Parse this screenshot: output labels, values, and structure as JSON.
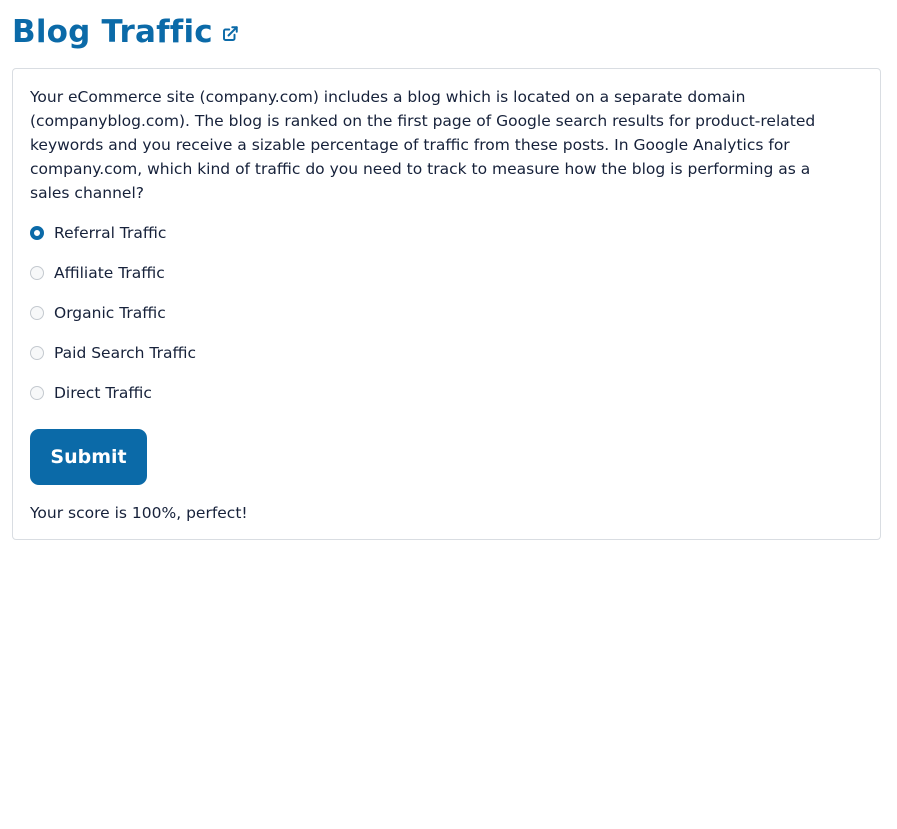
{
  "header": {
    "title": "Blog Traffic",
    "link_icon": "external-link-icon"
  },
  "quiz": {
    "question": "Your eCommerce site (company.com) includes a blog which is located on a separate domain (companyblog.com). The blog is ranked on the first page of Google search results for product-related keywords and you receive a sizable percentage of traffic from these posts. In Google Analytics for company.com, which kind of traffic do you need to track to measure how the blog is performing as a sales channel?",
    "options": [
      {
        "label": "Referral Traffic",
        "checked": true
      },
      {
        "label": "Affiliate Traffic",
        "checked": false
      },
      {
        "label": "Organic Traffic",
        "checked": false
      },
      {
        "label": "Paid Search Traffic",
        "checked": false
      },
      {
        "label": "Direct Traffic",
        "checked": false
      }
    ],
    "submit_label": "Submit",
    "score_text": "Your score is 100%, perfect!"
  },
  "colors": {
    "accent": "#0b6aa8",
    "text": "#16213a",
    "border": "#d9dde2"
  }
}
